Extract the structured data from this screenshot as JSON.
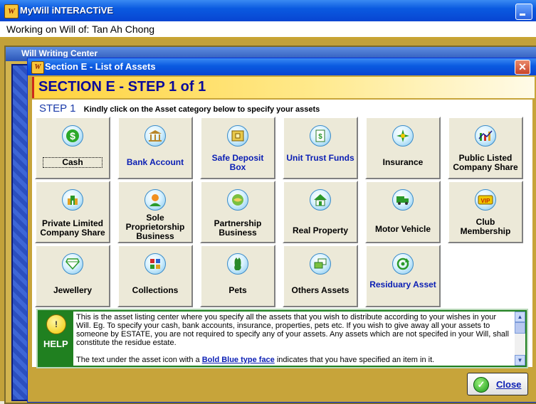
{
  "app": {
    "title": "MyWill iNTERACTiVE",
    "icon_letter": "W",
    "working_on": "Working on Will of: Tan Ah Chong"
  },
  "background_window": {
    "title": "Will Writing Center"
  },
  "dialog": {
    "title": "Section E - List of Assets",
    "close_glyph": "✕",
    "section_header": "SECTION E - STEP 1 of 1",
    "step_label": "STEP 1",
    "step_instruction": "Kindly click on the Asset category below to specify your assets",
    "assets": [
      {
        "label": "Cash",
        "style": "black",
        "focused": true,
        "icon": "dollar-icon"
      },
      {
        "label": "Bank Account",
        "style": "blue",
        "icon": "bank-icon"
      },
      {
        "label": "Safe Deposit Box",
        "style": "blue",
        "icon": "safe-deposit-icon"
      },
      {
        "label": "Unit Trust Funds",
        "style": "blue",
        "icon": "unit-trust-icon"
      },
      {
        "label": "Insurance",
        "style": "black",
        "icon": "insurance-icon"
      },
      {
        "label": "Public Listed Company Share",
        "style": "black",
        "icon": "stock-chart-icon"
      },
      {
        "label": "Private Limited Company Share",
        "style": "black",
        "icon": "building-icon"
      },
      {
        "label": "Sole Proprietorship Business",
        "style": "black",
        "icon": "person-icon"
      },
      {
        "label": "Partnership Business",
        "style": "black",
        "icon": "handshake-icon"
      },
      {
        "label": "Real Property",
        "style": "black",
        "icon": "house-icon"
      },
      {
        "label": "Motor Vehicle",
        "style": "black",
        "icon": "truck-icon"
      },
      {
        "label": "Club Membership",
        "style": "black",
        "icon": "vip-card-icon"
      },
      {
        "label": "Jewellery",
        "style": "black",
        "icon": "diamond-icon"
      },
      {
        "label": "Collections",
        "style": "black",
        "icon": "collection-icon"
      },
      {
        "label": "Pets",
        "style": "black",
        "icon": "cat-icon"
      },
      {
        "label": "Others Assets",
        "style": "black",
        "icon": "stack-icon"
      },
      {
        "label": "Residuary Asset",
        "style": "blue",
        "icon": "recycle-icon"
      }
    ],
    "help": {
      "label": "HELP",
      "icon_glyph": "!",
      "text_1": "This is the asset listing center where you specify all the assets that you wish to distribute according to your wishes in your Will. Eg. To specify your cash, bank accounts, insurance, properties, pets etc. If you wish to give away all your assets to someone by ESTATE, you are not required to specify any of your assets. Any assets which are not specifed in your Will, shall constitute the residue estate.",
      "text_2_prefix": "The text under the asset icon with a ",
      "text_2_emph": "Bold Blue type face",
      "text_2_suffix": " indicates that you have specified an item in it."
    },
    "close_button": {
      "label": "Close",
      "glyph": "✓"
    }
  },
  "colors": {
    "title_blue": "#0a5ae0",
    "gold": "#c7a43a",
    "specified_blue": "#0a1eb4",
    "help_green": "#208020"
  }
}
